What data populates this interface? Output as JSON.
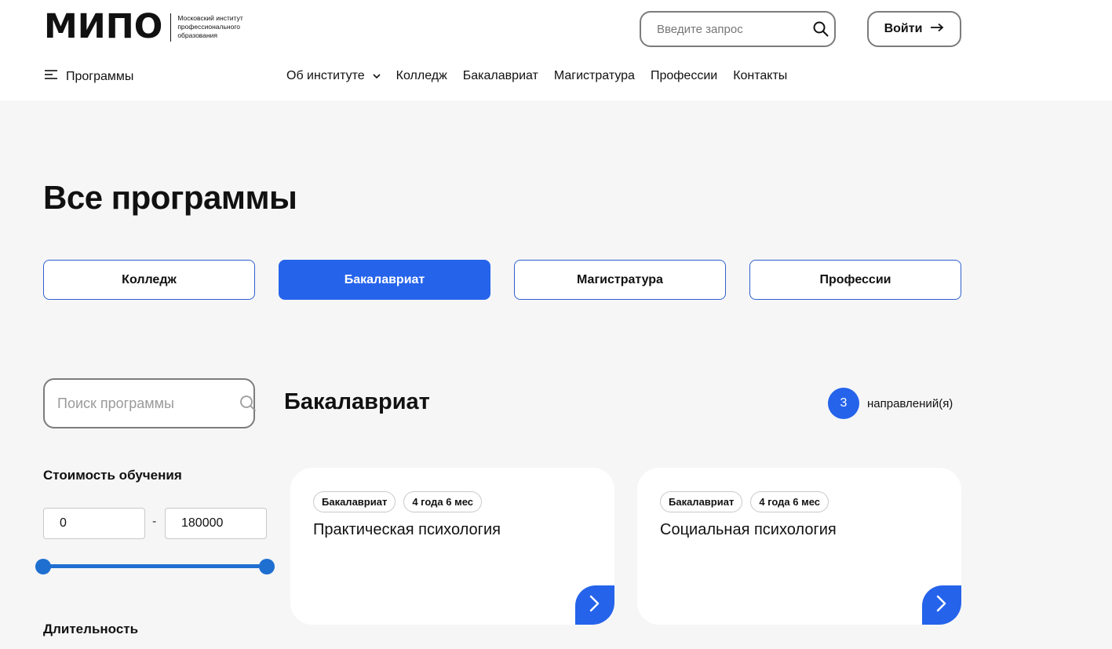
{
  "brand": {
    "logo": "МИПО",
    "subtitle": "Московский институт профессионального образования"
  },
  "header": {
    "search_placeholder": "Введите запрос",
    "login_label": "Войти",
    "programs_menu_label": "Программы",
    "nav": [
      {
        "label": "Об институте",
        "has_dropdown": true
      },
      {
        "label": "Колледж"
      },
      {
        "label": "Бакалавриат"
      },
      {
        "label": "Магистратура"
      },
      {
        "label": "Профессии"
      },
      {
        "label": "Контакты"
      }
    ]
  },
  "main": {
    "title": "Все программы",
    "categories": [
      {
        "label": "Колледж",
        "active": false
      },
      {
        "label": "Бакалавриат",
        "active": true
      },
      {
        "label": "Магистратура",
        "active": false
      },
      {
        "label": "Профессии",
        "active": false
      }
    ],
    "program_search_placeholder": "Поиск программы",
    "section_title": "Бакалавриат",
    "count": "3",
    "count_label": "направлений(я)"
  },
  "filters": {
    "price_title": "Стоимость обучения",
    "price_min": "0",
    "price_max": "180000",
    "price_range_selected": [
      0,
      1
    ],
    "duration_title": "Длительность"
  },
  "cards": [
    {
      "tags": [
        "Бакалавриат",
        "4 года 6 мес"
      ],
      "title": "Практическая психология"
    },
    {
      "tags": [
        "Бакалавриат",
        "4 года 6 мес"
      ],
      "title": "Социальная психология"
    }
  ],
  "colors": {
    "accent": "#2563eb",
    "slider": "#1f6fd1",
    "page_bg": "#f6f6f6"
  },
  "icons": {
    "search": "search-icon",
    "login_arrow": "arrow-right-icon",
    "menu": "hamburger-icon",
    "dropdown": "chevron-down-icon",
    "card_arrow": "chevron-right-icon"
  }
}
